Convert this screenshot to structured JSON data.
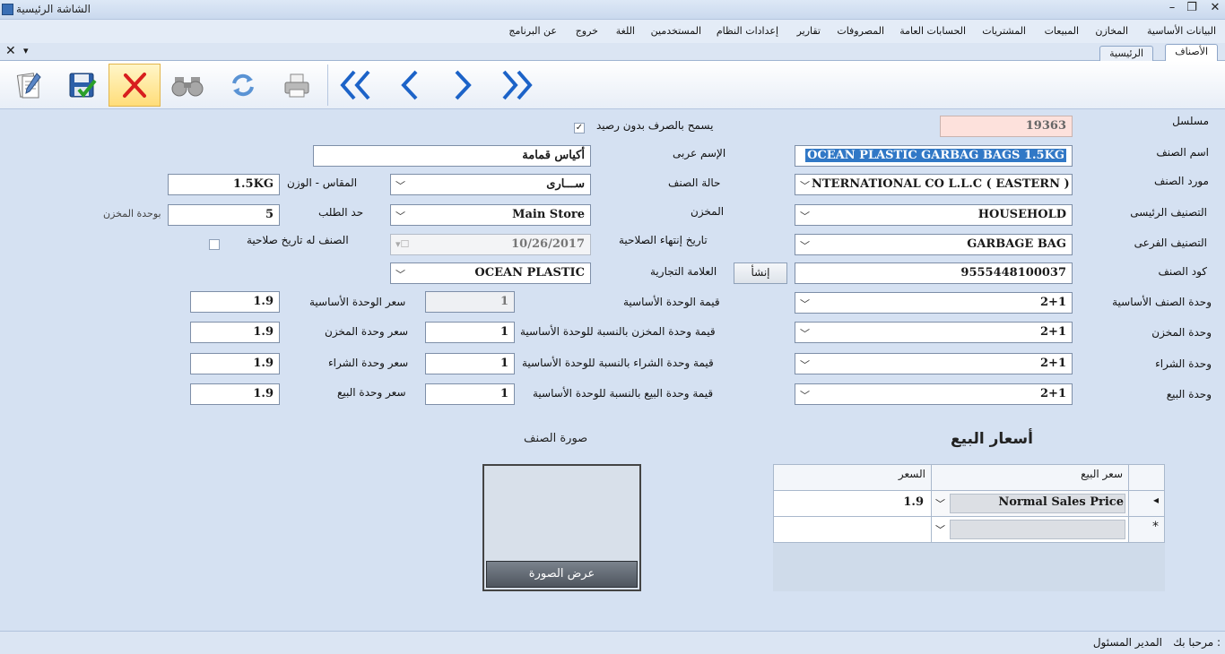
{
  "window": {
    "title": "الشاشة الرئيسية"
  },
  "window_buttons": {
    "close": "✕",
    "restore": "❐",
    "minimize": "–"
  },
  "menu": [
    "البيانات الأساسية",
    "المخازن",
    "المبيعات",
    "المشتريات",
    "الحسابات العامة",
    "المصروفات",
    "تقارير",
    "إعدادات النظام",
    "المستخدمين",
    "اللغة",
    "خروج",
    "عن البرنامج"
  ],
  "tabs": {
    "items": [
      "الأصناف",
      "الرئيسية"
    ],
    "close": "✕",
    "pin": "▾"
  },
  "toolbar": [
    "edit-icon",
    "save-icon",
    "delete-icon",
    "search-icon",
    "refresh-icon",
    "print-icon",
    "first-icon",
    "prev-icon",
    "next-icon",
    "last-icon"
  ],
  "form": {
    "serial": {
      "label": "مسلسل",
      "value": "19363"
    },
    "allow_no_balance": {
      "label": "يسمح بالصرف بدون رصيد",
      "checked": "✓"
    },
    "item_name": {
      "label": "اسم الصنف",
      "value": "OCEAN PLASTIC GARBAG BAGS 1.5KG"
    },
    "arabic_name": {
      "label": "الإسم عربى",
      "value": "أكياس قمامة"
    },
    "supplier": {
      "label": "مورد الصنف",
      "value": "NTERNATIONAL CO L.L.C ( EASTERN )"
    },
    "status": {
      "label": "حالة الصنف",
      "value": "ســـارى"
    },
    "size_weight": {
      "label": "المقاس - الوزن",
      "value": "1.5KG"
    },
    "main_category": {
      "label": "التصنيف الرئيسى",
      "value": "HOUSEHOLD"
    },
    "store": {
      "label": "المخزن",
      "value": "Main Store"
    },
    "reorder_limit": {
      "label": "حد الطلب",
      "value": "5"
    },
    "store_unit_hint": "بوحدة المخزن",
    "sub_category": {
      "label": "التصنيف الفرعى",
      "value": "GARBAGE BAG"
    },
    "expiry_date": {
      "label": "تاريخ إنتهاء الصلاحية",
      "value": "10/26/2017"
    },
    "has_expiry": {
      "label": "الصنف له تاريخ صلاحية"
    },
    "item_code": {
      "label": "كود الصنف",
      "value": "9555448100037"
    },
    "create_button": "إنشأ",
    "brand": {
      "label": "العلامة التجارية",
      "value": "OCEAN PLASTIC"
    },
    "base_unit": {
      "label": "وحدة الصنف الأساسية",
      "value": "2+1"
    },
    "base_unit_value": {
      "label": "قيمة الوحدة الأساسية",
      "value": "1"
    },
    "base_unit_price": {
      "label": "سعر الوحدة الأساسية",
      "value": "1.9"
    },
    "store_unit": {
      "label": "وحدة المخزن",
      "value": "2+1"
    },
    "store_unit_value": {
      "label": "قيمة وحدة المخزن بالنسبة للوحدة الأساسية",
      "value": "1"
    },
    "store_unit_price": {
      "label": "سعر وحدة المخزن",
      "value": "1.9"
    },
    "purchase_unit": {
      "label": "وحدة الشراء",
      "value": "2+1"
    },
    "purchase_unit_value": {
      "label": "قيمة وحدة الشراء بالنسبة للوحدة الأساسية",
      "value": "1"
    },
    "purchase_unit_price": {
      "label": "سعر وحدة الشراء",
      "value": "1.9"
    },
    "sales_unit": {
      "label": "وحدة البيع",
      "value": "2+1"
    },
    "sales_unit_value": {
      "label": "قيمة وحدة البيع بالنسبة للوحدة الأساسية",
      "value": "1"
    },
    "sales_unit_price": {
      "label": "سعر وحدة البيع",
      "value": "1.9"
    }
  },
  "sales_prices": {
    "title": "أسعار البيع",
    "columns": [
      "سعر البيع",
      "السعر"
    ],
    "rows": [
      {
        "marker": "◂",
        "type": "Normal Sales Price",
        "price": "1.9"
      }
    ],
    "new_row_marker": "*"
  },
  "item_image": {
    "title": "صورة الصنف",
    "button": "عرض الصورة"
  },
  "status": {
    "welcome": "مرحبا بك :",
    "user": "المدير المسئول"
  }
}
